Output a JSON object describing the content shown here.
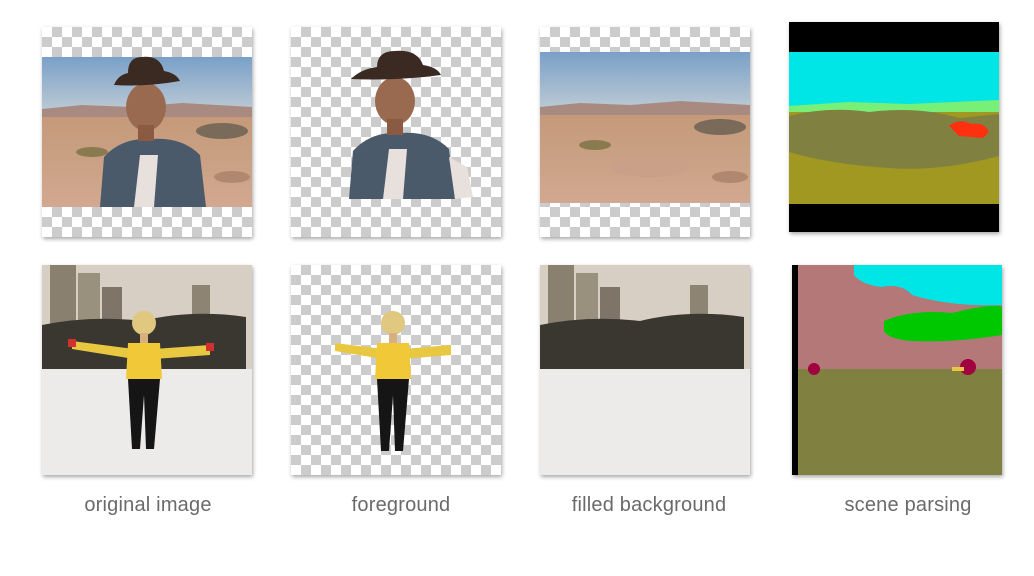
{
  "captions": {
    "original": "original image",
    "foreground": "foreground",
    "background": "filled background",
    "parsing": "scene parsing"
  },
  "colors": {
    "caption_text": "#6a6a6a",
    "parsing_sky": "#00e6e6",
    "parsing_ground": "#808040",
    "parsing_sand": "#a09820",
    "parsing_mountain": "#78f078",
    "parsing_rock": "#ff3010",
    "parsing_building": "#b47878",
    "parsing_tree": "#00c800",
    "parsing_person": "#a00040"
  }
}
